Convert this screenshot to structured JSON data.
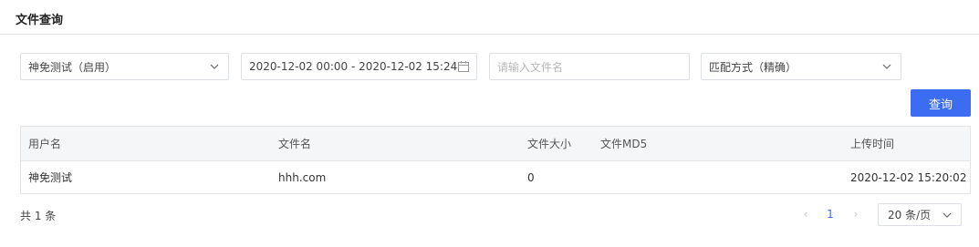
{
  "header": {
    "title": "文件查询"
  },
  "filters": {
    "user_select": {
      "value": "神免测试（启用）"
    },
    "date_range": {
      "value": "2020-12-02 00:00 - 2020-12-02 15:24"
    },
    "filename_input": {
      "placeholder": "请输入文件名"
    },
    "match_select": {
      "value": "匹配方式（精确）"
    },
    "query_button": "查询"
  },
  "table": {
    "columns": [
      "用户名",
      "文件名",
      "文件大小",
      "文件MD5",
      "上传时间"
    ],
    "rows": [
      [
        "神免测试",
        "hhh.com",
        "0",
        "",
        "2020-12-02 15:20:02"
      ]
    ]
  },
  "pagination": {
    "total_text": "共 1 条",
    "prev": "‹",
    "current_page": "1",
    "next": "›",
    "page_size": "20 条/页"
  },
  "colors": {
    "primary": "#3b6cf2",
    "border": "#dcdfe6",
    "header_bg": "#f5f6f8"
  },
  "icons": {
    "select_arrow": "chevron-down-icon",
    "date": "calendar-icon"
  }
}
